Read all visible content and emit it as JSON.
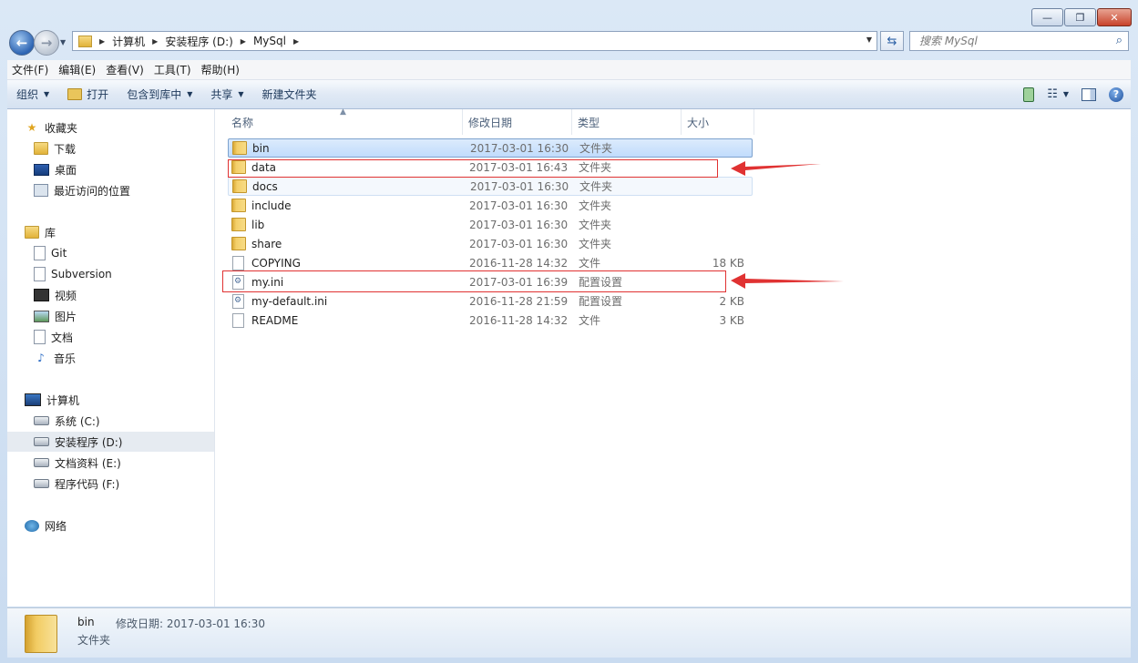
{
  "window": {
    "caption_buttons": [
      "—",
      "❐",
      "✕"
    ]
  },
  "address": {
    "crumbs": [
      "计算机",
      "安装程序 (D:)",
      "MySql"
    ]
  },
  "search": {
    "placeholder": "搜索 MySql"
  },
  "menu": [
    "文件(F)",
    "编辑(E)",
    "查看(V)",
    "工具(T)",
    "帮助(H)"
  ],
  "toolbar": {
    "organize": "组织",
    "open": "打开",
    "include_library": "包含到库中",
    "share": "共享",
    "new_folder": "新建文件夹"
  },
  "nav": {
    "favorites": "收藏夹",
    "downloads": "下载",
    "desktop": "桌面",
    "recent": "最近访问的位置",
    "libraries": "库",
    "git": "Git",
    "subversion": "Subversion",
    "videos": "视频",
    "pictures": "图片",
    "documents": "文档",
    "music": "音乐",
    "computer": "计算机",
    "drive_c": "系统 (C:)",
    "drive_d": "安装程序 (D:)",
    "drive_e": "文档资料 (E:)",
    "drive_f": "程序代码 (F:)",
    "network": "网络"
  },
  "columns": [
    "名称",
    "修改日期",
    "类型",
    "大小"
  ],
  "files": [
    {
      "name": "bin",
      "date": "2017-03-01 16:30",
      "type": "文件夹",
      "size": "",
      "kind": "folder"
    },
    {
      "name": "data",
      "date": "2017-03-01 16:43",
      "type": "文件夹",
      "size": "",
      "kind": "folder"
    },
    {
      "name": "docs",
      "date": "2017-03-01 16:30",
      "type": "文件夹",
      "size": "",
      "kind": "folder"
    },
    {
      "name": "include",
      "date": "2017-03-01 16:30",
      "type": "文件夹",
      "size": "",
      "kind": "folder"
    },
    {
      "name": "lib",
      "date": "2017-03-01 16:30",
      "type": "文件夹",
      "size": "",
      "kind": "folder"
    },
    {
      "name": "share",
      "date": "2017-03-01 16:30",
      "type": "文件夹",
      "size": "",
      "kind": "folder"
    },
    {
      "name": "COPYING",
      "date": "2016-11-28 14:32",
      "type": "文件",
      "size": "18 KB",
      "kind": "file"
    },
    {
      "name": "my.ini",
      "date": "2017-03-01 16:39",
      "type": "配置设置",
      "size": "",
      "kind": "config"
    },
    {
      "name": "my-default.ini",
      "date": "2016-11-28 21:59",
      "type": "配置设置",
      "size": "2 KB",
      "kind": "config"
    },
    {
      "name": "README",
      "date": "2016-11-28 14:32",
      "type": "文件",
      "size": "3 KB",
      "kind": "file"
    }
  ],
  "details": {
    "name": "bin",
    "modified": "修改日期: 2017-03-01 16:30",
    "type": "文件夹"
  },
  "colors": {
    "annotation_red": "#e03232",
    "selection_blue": "#c1dcfc"
  }
}
